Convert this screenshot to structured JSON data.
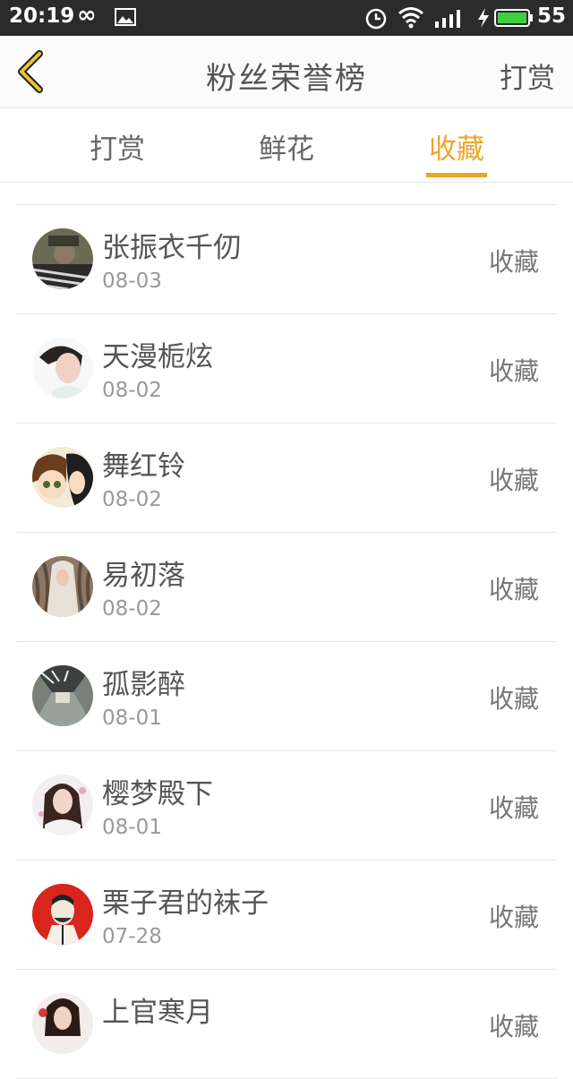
{
  "status_bar": {
    "time": "20:19",
    "infinity_glyph": "∞",
    "battery": "55",
    "icons": [
      "infinity-icon",
      "image-icon",
      "alarm-icon",
      "wifi-icon",
      "signal-icon",
      "charging-icon",
      "battery-icon"
    ]
  },
  "header": {
    "title": "粉丝荣誉榜",
    "action": "打赏",
    "back_icon": "chevron-left-icon"
  },
  "tabs": [
    {
      "label": "打赏",
      "active": false
    },
    {
      "label": "鲜花",
      "active": false
    },
    {
      "label": "收藏",
      "active": true
    }
  ],
  "colors": {
    "accent": "#eea52a",
    "statusbar": "#2b2b2b",
    "text": "#555555",
    "subtext": "#999999"
  },
  "fans": [
    {
      "name": "张振衣千仞",
      "date": "08-03",
      "action": "收藏"
    },
    {
      "name": "天漫栀炫",
      "date": "08-02",
      "action": "收藏"
    },
    {
      "name": "舞红铃",
      "date": "08-02",
      "action": "收藏"
    },
    {
      "name": "易初落",
      "date": "08-02",
      "action": "收藏"
    },
    {
      "name": "孤影醉",
      "date": "08-01",
      "action": "收藏"
    },
    {
      "name": "樱梦殿下",
      "date": "08-01",
      "action": "收藏"
    },
    {
      "name": "栗子君的袜子",
      "date": "07-28",
      "action": "收藏"
    },
    {
      "name": "上官寒月",
      "date": "",
      "action": "收藏"
    }
  ]
}
